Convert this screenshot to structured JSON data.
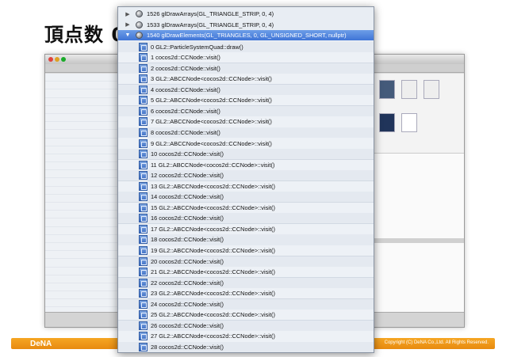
{
  "slide": {
    "title": "頂点数 0",
    "brand": "DeNA",
    "copyright": "Copyright (C) DeNA Co.,Ltd. All Rights Reserved."
  },
  "calls": [
    {
      "label": "1526 glDrawArrays(GL_TRIANGLE_STRIP, 0, 4)",
      "expanded": false
    },
    {
      "label": "1533 glDrawArrays(GL_TRIANGLE_STRIP, 0, 4)",
      "expanded": false
    },
    {
      "label": "1540 glDrawElements(GL_TRIANGLES, 0, GL_UNSIGNED_SHORT, nullptr)",
      "expanded": true,
      "selected": true
    }
  ],
  "frames": [
    "0 GL2::ParticleSystemQuad::draw()",
    "1 cocos2d::CCNode::visit()",
    "2 cocos2d::CCNode::visit()",
    "3 GL2::ABCCNode<cocos2d::CCNode>::visit()",
    "4 cocos2d::CCNode::visit()",
    "5 GL2::ABCCNode<cocos2d::CCNode>::visit()",
    "6 cocos2d::CCNode::visit()",
    "7 GL2::ABCCNode<cocos2d::CCNode>::visit()",
    "8 cocos2d::CCNode::visit()",
    "9 GL2::ABCCNode<cocos2d::CCNode>::visit()",
    "10 cocos2d::CCNode::visit()",
    "11 GL2::ABCCNode<cocos2d::CCNode>::visit()",
    "12 cocos2d::CCNode::visit()",
    "13 GL2::ABCCNode<cocos2d::CCNode>::visit()",
    "14 cocos2d::CCNode::visit()",
    "15 GL2::ABCCNode<cocos2d::CCNode>::visit()",
    "16 cocos2d::CCNode::visit()",
    "17 GL2::ABCCNode<cocos2d::CCNode>::visit()",
    "18 cocos2d::CCNode::visit()",
    "19 GL2::ABCCNode<cocos2d::CCNode>::visit()",
    "20 cocos2d::CCNode::visit()",
    "21 GL2::ABCCNode<cocos2d::CCNode>::visit()",
    "22 cocos2d::CCNode::visit()",
    "23 GL2::ABCCNode<cocos2d::CCNode>::visit()",
    "24 cocos2d::CCNode::visit()",
    "25 GL2::ABCCNode<cocos2d::CCNode>::visit()",
    "26 cocos2d::CCNode::visit()",
    "27 GL2::ABCCNode<cocos2d::CCNode>::visit()",
    "28 cocos2d::CCNode::visit()",
    "29 GL2::ABCCNode<cocos2d::CCNode>::visit()"
  ],
  "colors": {
    "selection": "#3f74d6",
    "footer": "#f6a623"
  }
}
